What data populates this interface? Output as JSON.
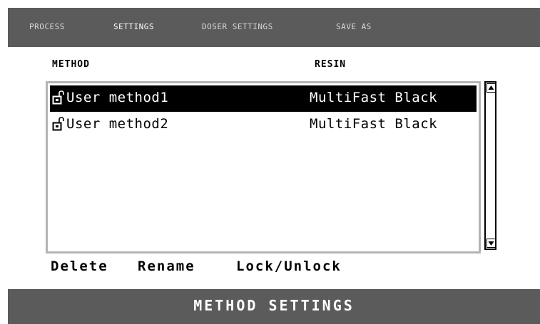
{
  "tabs": [
    {
      "label": "PROCESS",
      "active": false
    },
    {
      "label": "SETTINGS",
      "active": true
    },
    {
      "label": "DOSER SETTINGS",
      "active": false
    },
    {
      "label": "SAVE AS",
      "active": false
    }
  ],
  "columns": {
    "method": "METHOD",
    "resin": "RESIN"
  },
  "methods": [
    {
      "name": "User method1",
      "resin": "MultiFast Black",
      "icon": "unlocked-padlock-icon",
      "selected": true
    },
    {
      "name": "User method2",
      "resin": "MultiFast Black",
      "icon": "unlocked-padlock-icon",
      "selected": false
    }
  ],
  "scrollbar": {
    "up_icon": "scroll-up-arrow-icon",
    "down_icon": "scroll-down-arrow-icon"
  },
  "actions": {
    "delete": "Delete",
    "rename": "Rename",
    "lock_unlock": "Lock/Unlock"
  },
  "screen_title": "METHOD SETTINGS",
  "colors": {
    "bar_background": "#5b5b5b",
    "selection_background": "#000000",
    "list_border": "#b4b4b4",
    "text": "#000000",
    "bar_text": "#ffffff"
  }
}
